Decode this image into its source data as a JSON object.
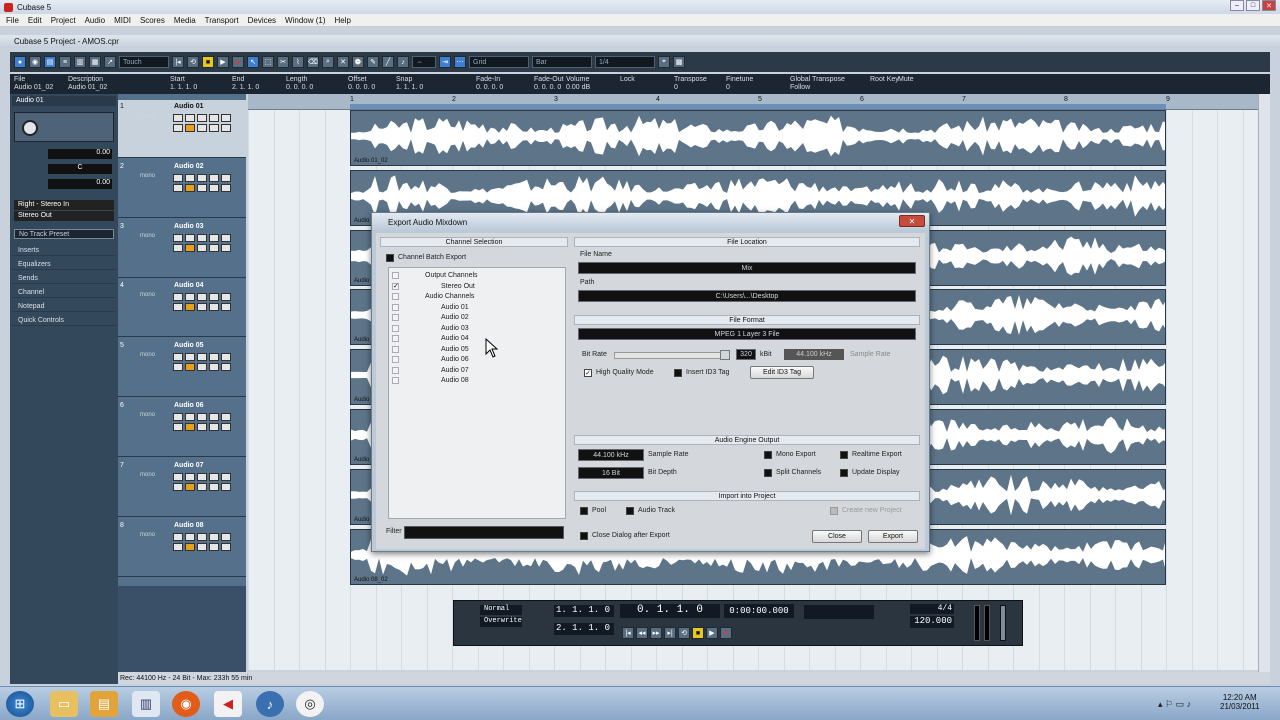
{
  "os": {
    "app_title": "Cubase 5",
    "menu": [
      "File",
      "Edit",
      "Project",
      "Audio",
      "MIDI",
      "Scores",
      "Media",
      "Transport",
      "Devices",
      "Window (1)",
      "Help"
    ]
  },
  "project": {
    "title": "Cubase 5 Project - AMOS.cpr"
  },
  "toolbar": {
    "mode": "Touch",
    "snap": "Bar",
    "quantize": "1/4",
    "grid": "Grid"
  },
  "infoline": {
    "headers": [
      "File",
      "Description",
      "Start",
      "End",
      "Length",
      "Offset",
      "Snap",
      "Fade-In",
      "Fade-Out",
      "Volume",
      "Lock",
      "Transpose",
      "Finetune",
      "Global Transpose",
      "Root Key",
      "Mute"
    ],
    "values": [
      "Audio 01_02",
      "Audio 01_02",
      "1. 1. 1. 0",
      "2. 1. 1. 0",
      "0. 0. 0. 0",
      "0. 0. 0. 0",
      "1. 1. 1. 0",
      "0. 0. 0. 0",
      "0. 0. 0. 0",
      "0.00 dB",
      "",
      "0",
      "0",
      "Follow",
      "",
      ""
    ]
  },
  "inspector": {
    "track_name": "Audio 01",
    "values": [
      "0.00",
      "C",
      "0.00"
    ],
    "routing": [
      "Right - Stereo In",
      "Stereo Out"
    ],
    "no_track_preset": "No Track Preset",
    "sections": [
      "Inserts",
      "Equalizers",
      "Sends",
      "Channel",
      "Notepad",
      "Quick Controls"
    ]
  },
  "tracks": [
    {
      "num": "1",
      "name": "Audio 01",
      "mono": "mono"
    },
    {
      "num": "2",
      "name": "Audio 02",
      "mono": "mono"
    },
    {
      "num": "3",
      "name": "Audio 03",
      "mono": "mono"
    },
    {
      "num": "4",
      "name": "Audio 04",
      "mono": "mono"
    },
    {
      "num": "5",
      "name": "Audio 05",
      "mono": "mono"
    },
    {
      "num": "6",
      "name": "Audio 06",
      "mono": "mono"
    },
    {
      "num": "7",
      "name": "Audio 07",
      "mono": "mono"
    },
    {
      "num": "8",
      "name": "Audio 08",
      "mono": "mono"
    }
  ],
  "ruler": {
    "marks": [
      "1",
      "2",
      "3",
      "4",
      "5",
      "6",
      "7",
      "8",
      "9"
    ]
  },
  "events": [
    "Audio 01_02",
    "Audio 02_02",
    "Audio 03_02",
    "Audio 04_02",
    "Audio 05_02",
    "Audio 06_02",
    "Audio 07_02",
    "Audio 08_02"
  ],
  "dialog": {
    "title": "Export Audio Mixdown",
    "channel_selection": "Channel Selection",
    "channel_batch_export": "Channel Batch Export",
    "channels": [
      {
        "label": "Output Channels",
        "checked": false,
        "indent": 0
      },
      {
        "label": "Stereo Out",
        "checked": true,
        "indent": 1
      },
      {
        "label": "Audio Channels",
        "checked": false,
        "indent": 0
      },
      {
        "label": "Audio 01",
        "checked": false,
        "indent": 1
      },
      {
        "label": "Audio 02",
        "checked": false,
        "indent": 1
      },
      {
        "label": "Audio 03",
        "checked": false,
        "indent": 1
      },
      {
        "label": "Audio 04",
        "checked": false,
        "indent": 1
      },
      {
        "label": "Audio 05",
        "checked": false,
        "indent": 1
      },
      {
        "label": "Audio 06",
        "checked": false,
        "indent": 1
      },
      {
        "label": "Audio 07",
        "checked": false,
        "indent": 1
      },
      {
        "label": "Audio 08",
        "checked": false,
        "indent": 1
      }
    ],
    "filter_label": "Filter",
    "file_location": "File Location",
    "name_label": "File Name",
    "name_value": "Mix",
    "path_label": "Path",
    "path_value": "C:\\Users\\...\\Desktop",
    "file_format": "File Format",
    "format_value": "MPEG 1 Layer 3 File",
    "bitrate_label": "Bit Rate",
    "bitrate_value": "320",
    "kbit_label": "kBit",
    "samplerate_small": "44.100 kHz",
    "sample_rate_label": "Sample Rate",
    "hq_mode": "High Quality Mode",
    "insert_id3": "Insert ID3 Tag",
    "edit_id3": "Edit ID3 Tag",
    "engine_output": "Audio Engine Output",
    "sample_rate_value": "44.100 kHz",
    "sample_rate_caption": "Sample Rate",
    "bit_depth_value": "16 Bit",
    "bit_depth_caption": "Bit Depth",
    "mono_export": "Mono Export",
    "realtime_export": "Realtime Export",
    "split_channels": "Split Channels",
    "update_display": "Update Display",
    "import_into_project": "Import into Project",
    "pool": "Pool",
    "audio_track": "Audio Track",
    "create_new_project": "Create new Project",
    "close_dialog_after_export": "Close Dialog after Export",
    "close_button": "Close",
    "export_button": "Export"
  },
  "transport": {
    "mode1": "Normal",
    "mode2": "Overwrite",
    "left_locator": "1. 1. 1. 0",
    "right_locator": "2. 1. 1. 0",
    "primary_time": "0. 1. 1. 0",
    "secondary_time": "0:00:00.000",
    "signature": "4/4",
    "tempo": "120.000"
  },
  "status": {
    "text": "Rec: 44100 Hz - 24 Bit - Max: 233h 55 min"
  },
  "clock": {
    "time": "12:20 AM",
    "date": "21/03/2011"
  }
}
